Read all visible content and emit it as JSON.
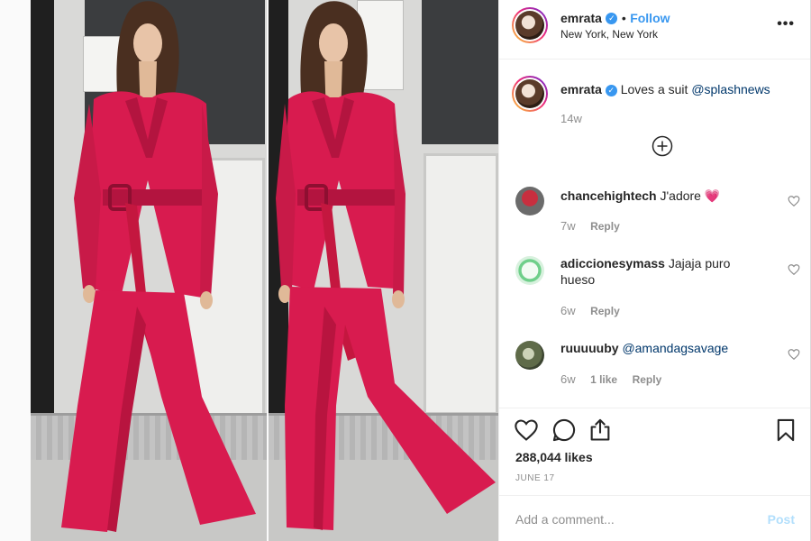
{
  "post": {
    "author": "emrata",
    "follow_label": "Follow",
    "separator": "•",
    "location": "New York, New York",
    "more_label": "•••"
  },
  "caption": {
    "author": "emrata",
    "text": "Loves a suit",
    "mention": "@splashnews",
    "time": "14w"
  },
  "comments": [
    {
      "username": "chancehightech",
      "text": "J'adore 💗",
      "time": "7w",
      "likes": "",
      "reply_label": "Reply"
    },
    {
      "username": "adiccionesymass",
      "text": "Jajaja puro hueso",
      "time": "6w",
      "likes": "",
      "reply_label": "Reply"
    },
    {
      "username": "ruuuuuby",
      "text": "@amandagsavage",
      "time": "6w",
      "likes": "1 like",
      "reply_label": "Reply"
    }
  ],
  "likes_count": "288,044 likes",
  "date": "JUNE 17",
  "add_comment": {
    "placeholder": "Add a comment...",
    "post_label": "Post"
  },
  "colors": {
    "link": "#3897f0",
    "mention": "#00376b",
    "muted": "#8e8e8e",
    "post_disabled": "#b2dffc",
    "suit": "#d81b4f"
  },
  "icons": [
    "verified-badge-icon",
    "more-options-icon",
    "load-more-comments-icon",
    "heart-icon",
    "comment-icon",
    "share-icon",
    "bookmark-icon"
  ]
}
